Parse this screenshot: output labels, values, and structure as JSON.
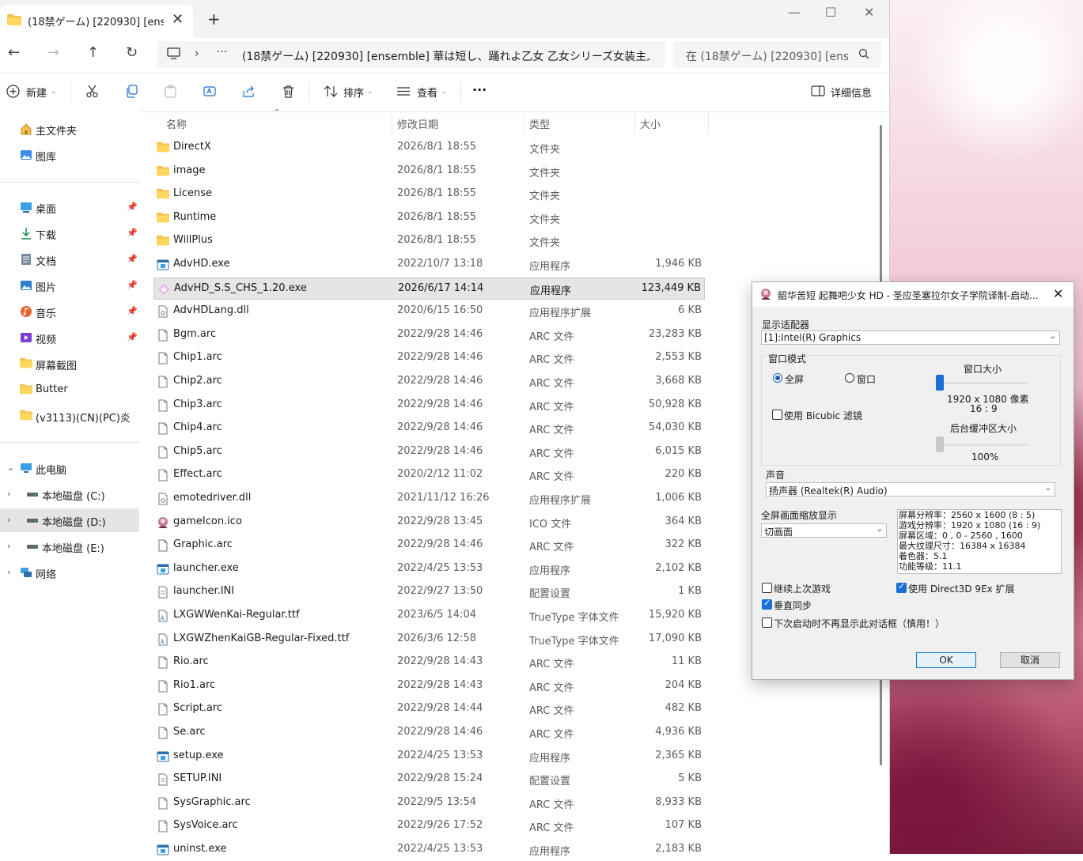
{
  "explorer": {
    "tab_title": "(18禁ゲーム) [220930] [ensem",
    "tab_close": "✕",
    "new_tab": "+",
    "window_controls": {
      "minimize": "—",
      "maximize": "☐",
      "close": "✕"
    },
    "nav": {
      "back": "←",
      "forward": "→",
      "up": "↑",
      "refresh": "↻"
    },
    "address": {
      "chevron": "›",
      "dots": "···",
      "path": "(18禁ゲーム) [220930] [ensemble] 華は短し、踊れよ乙女 乙女シリーズ女装主人"
    },
    "search_placeholder": "在 (18禁ゲーム) [220930] [ense",
    "toolbar": {
      "new_label": "新建",
      "sort_label": "排序",
      "view_label": "查看",
      "more_label": "···",
      "details_label": "详细信息"
    },
    "sidebar": {
      "top": [
        {
          "label": "主文件夹",
          "icon": "home-icon"
        },
        {
          "label": "图库",
          "icon": "gallery-icon"
        }
      ],
      "quick": [
        {
          "label": "桌面",
          "icon": "desktop-icon",
          "pinned": true
        },
        {
          "label": "下载",
          "icon": "download-icon",
          "pinned": true
        },
        {
          "label": "文档",
          "icon": "document-icon",
          "pinned": true
        },
        {
          "label": "图片",
          "icon": "pictures-icon",
          "pinned": true
        },
        {
          "label": "音乐",
          "icon": "music-icon",
          "pinned": true
        },
        {
          "label": "视频",
          "icon": "video-icon",
          "pinned": true
        },
        {
          "label": "屏幕截图",
          "icon": "folder-icon",
          "pinned": false
        },
        {
          "label": "Butter",
          "icon": "folder-icon",
          "pinned": false
        },
        {
          "label": "(v3113)(CN)(PC)炎",
          "icon": "folder-icon",
          "pinned": false
        }
      ],
      "tree": [
        {
          "label": "此电脑",
          "icon": "pc-icon",
          "expander": "⌄",
          "selected": false
        },
        {
          "label": "本地磁盘 (C:)",
          "icon": "drive-icon",
          "expander": "›",
          "selected": false
        },
        {
          "label": "本地磁盘 (D:)",
          "icon": "drive-icon",
          "expander": "›",
          "selected": true
        },
        {
          "label": "本地磁盘 (E:)",
          "icon": "drive-icon",
          "expander": "›",
          "selected": false
        },
        {
          "label": "网络",
          "icon": "network-icon",
          "expander": "›",
          "selected": false
        }
      ]
    },
    "columns": {
      "name": "名称",
      "date": "修改日期",
      "type": "类型",
      "size": "大小"
    },
    "files": [
      {
        "name": "DirectX",
        "date": "2026/8/1 18:55",
        "type": "文件夹",
        "size": "",
        "icon": "folder"
      },
      {
        "name": "image",
        "date": "2026/8/1 18:55",
        "type": "文件夹",
        "size": "",
        "icon": "folder"
      },
      {
        "name": "License",
        "date": "2026/8/1 18:55",
        "type": "文件夹",
        "size": "",
        "icon": "folder"
      },
      {
        "name": "Runtime",
        "date": "2026/8/1 18:55",
        "type": "文件夹",
        "size": "",
        "icon": "folder"
      },
      {
        "name": "WillPlus",
        "date": "2026/8/1 18:55",
        "type": "文件夹",
        "size": "",
        "icon": "folder"
      },
      {
        "name": "AdvHD.exe",
        "date": "2022/10/7 13:18",
        "type": "应用程序",
        "size": "1,946 KB",
        "icon": "exe"
      },
      {
        "name": "AdvHD_S.S_CHS_1.20.exe",
        "date": "2026/6/17 14:14",
        "type": "应用程序",
        "size": "123,449 KB",
        "icon": "exe-special",
        "selected": true
      },
      {
        "name": "AdvHDLang.dll",
        "date": "2020/6/15 16:50",
        "type": "应用程序扩展",
        "size": "6 KB",
        "icon": "dll"
      },
      {
        "name": "Bgm.arc",
        "date": "2022/9/28 14:46",
        "type": "ARC 文件",
        "size": "23,283 KB",
        "icon": "file"
      },
      {
        "name": "Chip1.arc",
        "date": "2022/9/28 14:46",
        "type": "ARC 文件",
        "size": "2,553 KB",
        "icon": "file"
      },
      {
        "name": "Chip2.arc",
        "date": "2022/9/28 14:46",
        "type": "ARC 文件",
        "size": "3,668 KB",
        "icon": "file"
      },
      {
        "name": "Chip3.arc",
        "date": "2022/9/28 14:46",
        "type": "ARC 文件",
        "size": "50,928 KB",
        "icon": "file"
      },
      {
        "name": "Chip4.arc",
        "date": "2022/9/28 14:46",
        "type": "ARC 文件",
        "size": "54,030 KB",
        "icon": "file"
      },
      {
        "name": "Chip5.arc",
        "date": "2022/9/28 14:46",
        "type": "ARC 文件",
        "size": "6,015 KB",
        "icon": "file"
      },
      {
        "name": "Effect.arc",
        "date": "2020/2/12 11:02",
        "type": "ARC 文件",
        "size": "220 KB",
        "icon": "file"
      },
      {
        "name": "emotedriver.dll",
        "date": "2021/11/12 16:26",
        "type": "应用程序扩展",
        "size": "1,006 KB",
        "icon": "dll"
      },
      {
        "name": "gameIcon.ico",
        "date": "2022/9/28 13:45",
        "type": "ICO 文件",
        "size": "364 KB",
        "icon": "ico"
      },
      {
        "name": "Graphic.arc",
        "date": "2022/9/28 14:46",
        "type": "ARC 文件",
        "size": "322 KB",
        "icon": "file"
      },
      {
        "name": "launcher.exe",
        "date": "2022/4/25 13:53",
        "type": "应用程序",
        "size": "2,102 KB",
        "icon": "exe"
      },
      {
        "name": "launcher.INI",
        "date": "2022/9/27 13:50",
        "type": "配置设置",
        "size": "1 KB",
        "icon": "ini"
      },
      {
        "name": "LXGWWenKai-Regular.ttf",
        "date": "2023/6/5 14:04",
        "type": "TrueType 字体文件",
        "size": "15,920 KB",
        "icon": "font"
      },
      {
        "name": "LXGWZhenKaiGB-Regular-Fixed.ttf",
        "date": "2026/3/6 12:58",
        "type": "TrueType 字体文件",
        "size": "17,090 KB",
        "icon": "font"
      },
      {
        "name": "Rio.arc",
        "date": "2022/9/28 14:43",
        "type": "ARC 文件",
        "size": "11 KB",
        "icon": "file"
      },
      {
        "name": "Rio1.arc",
        "date": "2022/9/28 14:43",
        "type": "ARC 文件",
        "size": "204 KB",
        "icon": "file"
      },
      {
        "name": "Script.arc",
        "date": "2022/9/28 14:44",
        "type": "ARC 文件",
        "size": "482 KB",
        "icon": "file"
      },
      {
        "name": "Se.arc",
        "date": "2022/9/28 14:46",
        "type": "ARC 文件",
        "size": "4,936 KB",
        "icon": "file"
      },
      {
        "name": "setup.exe",
        "date": "2022/4/25 13:53",
        "type": "应用程序",
        "size": "2,365 KB",
        "icon": "exe"
      },
      {
        "name": "SETUP.INI",
        "date": "2022/9/28 15:24",
        "type": "配置设置",
        "size": "5 KB",
        "icon": "ini"
      },
      {
        "name": "SysGraphic.arc",
        "date": "2022/9/5 13:54",
        "type": "ARC 文件",
        "size": "8,933 KB",
        "icon": "file"
      },
      {
        "name": "SysVoice.arc",
        "date": "2022/9/26 17:52",
        "type": "ARC 文件",
        "size": "107 KB",
        "icon": "file"
      },
      {
        "name": "uninst.exe",
        "date": "2022/4/25 13:53",
        "type": "应用程序",
        "size": "2,183 KB",
        "icon": "exe"
      }
    ]
  },
  "dialog": {
    "title": "韶华苦短 起舞吧少女 HD - 圣应圣塞拉尔女子学院译制-启动...",
    "close": "✕",
    "adapter_label": "显示适配器",
    "adapter_value": "[1]:Intel(R) Graphics",
    "window_mode_label": "窗口模式",
    "fullscreen_label": "全屏",
    "windowed_label": "窗口",
    "window_mode_selected": "fullscreen",
    "window_size_label": "窗口大小",
    "window_size_value": "1920 x 1080 像素",
    "aspect_value": "16 : 9",
    "bicubic_label": "使用 Bicubic 滤镜",
    "bicubic_checked": false,
    "backbuffer_label": "后台缓冲区大小",
    "backbuffer_value": "100%",
    "sound_label": "声音",
    "sound_value": "扬声器 (Realtek(R) Audio)",
    "fullscreen_scale_label": "全屏画面缩放显示",
    "fullscreen_scale_value": "切画面",
    "info_lines": [
      "屏幕分辨率：2560 x 1600 (8 : 5)",
      "游戏分辨率：1920 x 1080 (16 : 9)",
      "屏幕区域：0 , 0 - 2560 , 1600",
      "最大纹理尺寸：16384 x 16384",
      "着色器：5.1",
      "功能等级：11.1"
    ],
    "continue_label": "继续上次游戏",
    "continue_checked": false,
    "direct3d_label": "使用 Direct3D 9Ex 扩展",
    "direct3d_checked": true,
    "vsync_label": "垂直同步",
    "vsync_checked": true,
    "no_show_label": "下次启动时不再显示此对话框（慎用！）",
    "no_show_checked": false,
    "ok_label": "OK",
    "cancel_label": "取消"
  }
}
